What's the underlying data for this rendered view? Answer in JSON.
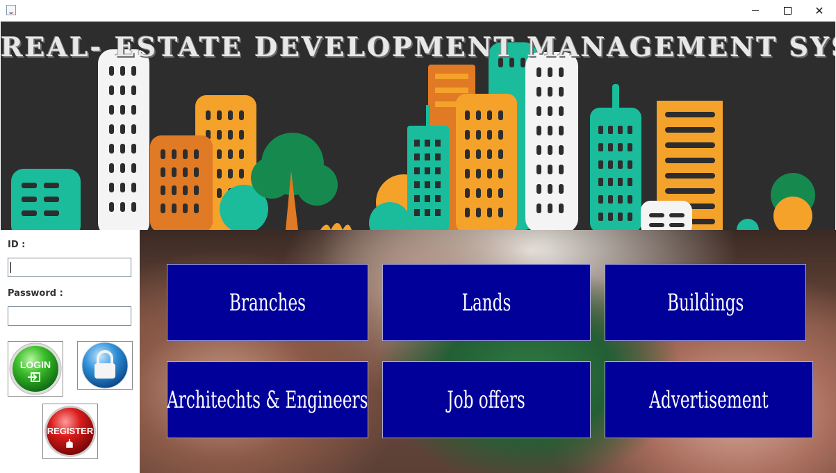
{
  "window": {
    "controls": {
      "minimize_icon": "minimize-icon",
      "maximize_icon": "maximize-icon",
      "close_icon": "close-icon",
      "close_glyph": "✕"
    }
  },
  "banner": {
    "title": "REAL- ESTATE DEVELOPMENT MANAGEMENT SYSTEM"
  },
  "login": {
    "id_label": "ID :",
    "id_value": "",
    "password_label": "Password :",
    "password_value": "",
    "login_button": "LOGIN",
    "register_button": "REGISTER"
  },
  "menu": {
    "tiles": [
      {
        "label": "Branches"
      },
      {
        "label": "Lands"
      },
      {
        "label": "Buildings"
      },
      {
        "label": "Architechts & Engineers"
      },
      {
        "label": "Job offers"
      },
      {
        "label": "Advertisement"
      }
    ]
  },
  "colors": {
    "tile_bg": "#01019a",
    "banner_bg": "#2d2d2d",
    "teal": "#1abc9c",
    "orange": "#f5a22a",
    "dark_orange": "#e07a24"
  }
}
